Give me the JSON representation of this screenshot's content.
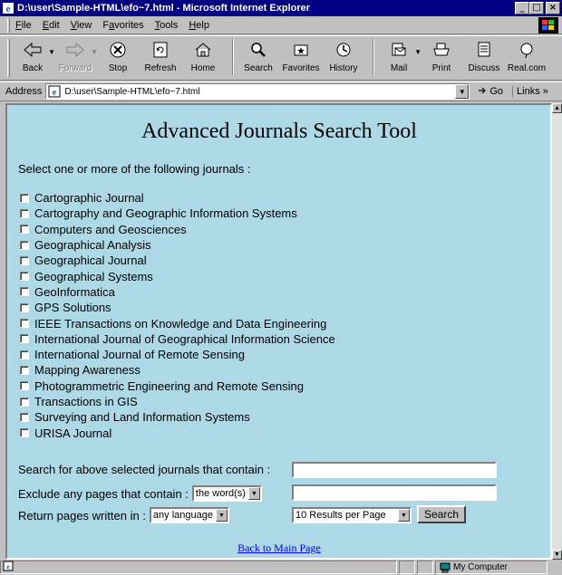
{
  "window": {
    "title": "D:\\user\\Sample-HTML\\efo~7.html - Microsoft Internet Explorer",
    "controls": {
      "minimize": "_",
      "maximize": "□",
      "close": "×"
    }
  },
  "menu": {
    "items": [
      {
        "label": "File",
        "mnemonic": "F"
      },
      {
        "label": "Edit",
        "mnemonic": "E"
      },
      {
        "label": "View",
        "mnemonic": "V"
      },
      {
        "label": "Favorites",
        "mnemonic": "a"
      },
      {
        "label": "Tools",
        "mnemonic": "T"
      },
      {
        "label": "Help",
        "mnemonic": "H"
      }
    ]
  },
  "toolbar": {
    "back": "Back",
    "forward": "Forward",
    "stop": "Stop",
    "refresh": "Refresh",
    "home": "Home",
    "search": "Search",
    "favorites": "Favorites",
    "history": "History",
    "mail": "Mail",
    "print": "Print",
    "discuss": "Discuss",
    "realcom": "Real.com"
  },
  "address": {
    "label": "Address",
    "value": "D:\\user\\Sample-HTML\\efo~7.html",
    "go": "Go",
    "links": "Links »"
  },
  "page": {
    "title": "Advanced Journals Search Tool",
    "instructions": "Select one or more of the following journals :",
    "journals": [
      "Cartographic Journal",
      "Cartography and Geographic Information Systems",
      "Computers and Geosciences",
      "Geographical Analysis",
      "Geographical Journal",
      "Geographical Systems",
      "GeoInformatica",
      "GPS Solutions",
      "IEEE Transactions on Knowledge and Data Engineering",
      "International Journal of Geographical Information Science",
      "International Journal of Remote Sensing",
      "Mapping Awareness",
      "Photogrammetric Engineering and Remote Sensing",
      "Transactions in GIS",
      "Surveying and Land Information Systems",
      "URISA Journal"
    ],
    "search_contain_label": "Search for above selected journals that contain :",
    "exclude_label": "Exclude any pages that contain :",
    "exclude_select": "the word(s)",
    "language_label": "Return pages written in :",
    "language_select": "any language",
    "results_select": "10 Results per Page",
    "search_button": "Search",
    "back_link": "Back to Main Page"
  },
  "status": {
    "text": "",
    "zone": "My Computer"
  },
  "colors": {
    "titlebar": "#000080",
    "content_bg": "#add8e6",
    "link": "#0000ee",
    "chrome": "#c0c0c0"
  }
}
